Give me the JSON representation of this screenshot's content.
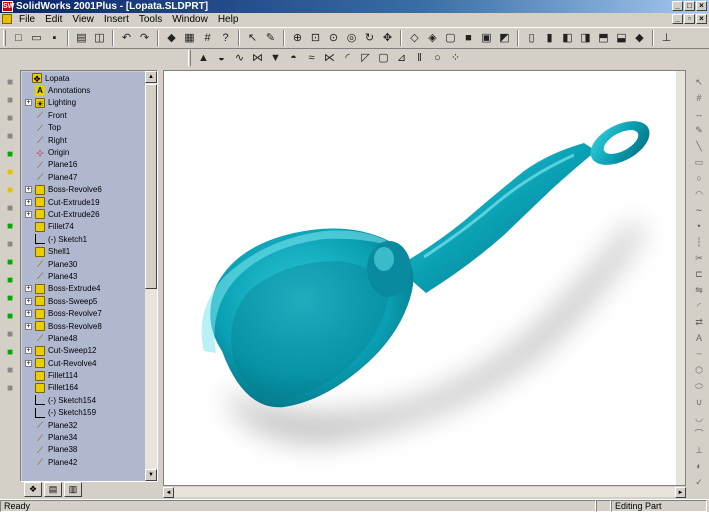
{
  "window": {
    "title": "SolidWorks 2001Plus - [Lopata.SLDPRT]",
    "app_icon": "SW"
  },
  "menu": [
    "File",
    "Edit",
    "View",
    "Insert",
    "Tools",
    "Window",
    "Help"
  ],
  "toolbar_main": [
    "new-icon",
    "open-icon",
    "save-icon",
    "|",
    "print-icon",
    "print-preview-icon",
    "|",
    "undo-icon",
    "redo-icon",
    "|",
    "rebuild-icon",
    "options-icon",
    "grid-icon",
    "help-whats-this-icon",
    "|",
    "select-icon",
    "sketch-icon",
    "|",
    "zoom-fit-icon",
    "zoom-window-icon",
    "zoom-in-out-icon",
    "zoom-selection-icon",
    "rotate-icon",
    "pan-icon",
    "|",
    "wireframe-icon",
    "hidden-lines-icon",
    "hidden-removed-icon",
    "shaded-icon",
    "shaded-edges-icon",
    "perspective-icon",
    "|",
    "front-view-icon",
    "back-view-icon",
    "left-view-icon",
    "right-view-icon",
    "top-view-icon",
    "bottom-view-icon",
    "iso-view-icon",
    "|",
    "normal-to-icon"
  ],
  "toolbar_features": [
    "extrude-icon",
    "revolve-icon",
    "sweep-icon",
    "loft-icon",
    "cut-extrude-icon",
    "cut-revolve-icon",
    "cut-sweep-icon",
    "cut-loft-icon",
    "fillet-icon",
    "chamfer-icon",
    "shell-icon",
    "draft-icon",
    "rib-icon",
    "hole-icon",
    "pattern-icon"
  ],
  "left_toolbar": [
    "feature-1",
    "feature-2",
    "feature-3",
    "feature-4",
    "feature-5",
    "feature-6",
    "feature-7",
    "feature-8",
    "feature-9",
    "feature-10",
    "feature-11",
    "feature-12",
    "feature-13",
    "feature-14",
    "feature-15",
    "feature-16",
    "feature-17",
    "feature-18"
  ],
  "right_toolbar": [
    "select-icon",
    "grid-icon",
    "smart-dimension-icon",
    "sketch-icon",
    "line-icon",
    "rectangle-icon",
    "circle-icon",
    "arc-icon",
    "spline-icon",
    "point-icon",
    "centerline-icon",
    "trim-icon",
    "offset-icon",
    "mirror-icon",
    "fillet-icon",
    "convert-icon",
    "text-icon",
    "construction-icon",
    "polygon-icon",
    "ellipse-icon",
    "parabola-icon",
    "tangent-arc-icon",
    "three-point-arc-icon",
    "relation-icon",
    "display-icon",
    "repair-icon"
  ],
  "tree": [
    {
      "label": "Lopata",
      "type": "part",
      "expand": false,
      "level": 0
    },
    {
      "label": "Annotations",
      "type": "annot",
      "expand": false,
      "level": 1
    },
    {
      "label": "Lighting",
      "type": "light",
      "expand": true,
      "level": 1
    },
    {
      "label": "Front",
      "type": "plane",
      "expand": false,
      "level": 1
    },
    {
      "label": "Top",
      "type": "plane",
      "expand": false,
      "level": 1
    },
    {
      "label": "Right",
      "type": "plane",
      "expand": false,
      "level": 1
    },
    {
      "label": "Origin",
      "type": "origin",
      "expand": false,
      "level": 1
    },
    {
      "label": "Plane16",
      "type": "plane",
      "expand": false,
      "level": 1
    },
    {
      "label": "Plane47",
      "type": "plane",
      "expand": false,
      "level": 1
    },
    {
      "label": "Boss-Revolve6",
      "type": "feat",
      "expand": true,
      "level": 1
    },
    {
      "label": "Cut-Extrude19",
      "type": "feat",
      "expand": true,
      "level": 1
    },
    {
      "label": "Cut-Extrude26",
      "type": "feat",
      "expand": true,
      "level": 1
    },
    {
      "label": "Fillet74",
      "type": "feat",
      "expand": false,
      "level": 1
    },
    {
      "label": "(-) Sketch1",
      "type": "sketch",
      "expand": false,
      "level": 1
    },
    {
      "label": "Shell1",
      "type": "feat",
      "expand": false,
      "level": 1
    },
    {
      "label": "Plane30",
      "type": "plane",
      "expand": false,
      "level": 1
    },
    {
      "label": "Plane43",
      "type": "plane",
      "expand": false,
      "level": 1
    },
    {
      "label": "Boss-Extrude4",
      "type": "feat",
      "expand": true,
      "level": 1
    },
    {
      "label": "Boss-Sweep5",
      "type": "feat",
      "expand": true,
      "level": 1
    },
    {
      "label": "Boss-Revolve7",
      "type": "feat",
      "expand": true,
      "level": 1
    },
    {
      "label": "Boss-Revolve8",
      "type": "feat",
      "expand": true,
      "level": 1
    },
    {
      "label": "Plane48",
      "type": "plane",
      "expand": false,
      "level": 1
    },
    {
      "label": "Cut-Sweep12",
      "type": "feat",
      "expand": true,
      "level": 1
    },
    {
      "label": "Cut-Revolve4",
      "type": "feat",
      "expand": true,
      "level": 1
    },
    {
      "label": "Fillet114",
      "type": "feat",
      "expand": false,
      "level": 1
    },
    {
      "label": "Fillet164",
      "type": "feat",
      "expand": false,
      "level": 1
    },
    {
      "label": "(-) Sketch154",
      "type": "sketch",
      "expand": false,
      "level": 1
    },
    {
      "label": "(-) Sketch159",
      "type": "sketch",
      "expand": false,
      "level": 1
    },
    {
      "label": "Plane32",
      "type": "plane",
      "expand": false,
      "level": 1
    },
    {
      "label": "Plane34",
      "type": "plane",
      "expand": false,
      "level": 1
    },
    {
      "label": "Plane38",
      "type": "plane",
      "expand": false,
      "level": 1
    },
    {
      "label": "Plane42",
      "type": "plane",
      "expand": false,
      "level": 1
    }
  ],
  "tree_tabs": [
    "feature-manager-icon",
    "property-manager-icon",
    "configuration-manager-icon"
  ],
  "model": {
    "color": "#0aa0b4",
    "name": "scoop"
  },
  "status": {
    "left": "Ready",
    "right": "Editing Part"
  }
}
